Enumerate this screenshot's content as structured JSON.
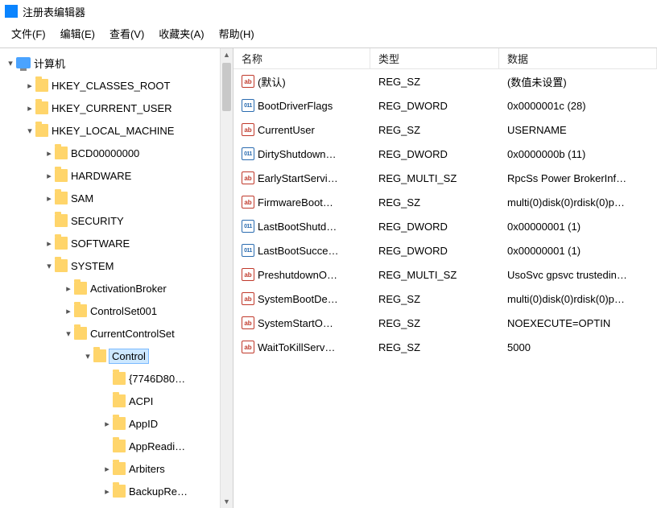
{
  "window": {
    "title": "注册表编辑器"
  },
  "menu": {
    "file": "文件(F)",
    "edit": "编辑(E)",
    "view": "查看(V)",
    "fav": "收藏夹(A)",
    "help": "帮助(H)"
  },
  "tree": {
    "root": "计算机",
    "n0": "HKEY_CLASSES_ROOT",
    "n1": "HKEY_CURRENT_USER",
    "n2": "HKEY_LOCAL_MACHINE",
    "n2_0": "BCD00000000",
    "n2_1": "HARDWARE",
    "n2_2": "SAM",
    "n2_3": "SECURITY",
    "n2_4": "SOFTWARE",
    "n2_5": "SYSTEM",
    "n2_5_0": "ActivationBroker",
    "n2_5_1": "ControlSet001",
    "n2_5_2": "CurrentControlSet",
    "n2_5_2_0": "Control",
    "n2_5_2_0_0": "{7746D80…",
    "n2_5_2_0_1": "ACPI",
    "n2_5_2_0_2": "AppID",
    "n2_5_2_0_3": "AppReadi…",
    "n2_5_2_0_4": "Arbiters",
    "n2_5_2_0_5": "BackupRe…"
  },
  "columns": {
    "name": "名称",
    "type": "类型",
    "data": "数据"
  },
  "values": [
    {
      "icon": "sz",
      "name": "(默认)",
      "type": "REG_SZ",
      "data": "(数值未设置)"
    },
    {
      "icon": "dw",
      "name": "BootDriverFlags",
      "type": "REG_DWORD",
      "data": "0x0000001c (28)"
    },
    {
      "icon": "sz",
      "name": "CurrentUser",
      "type": "REG_SZ",
      "data": "USERNAME"
    },
    {
      "icon": "dw",
      "name": "DirtyShutdown…",
      "type": "REG_DWORD",
      "data": "0x0000000b (11)"
    },
    {
      "icon": "sz",
      "name": "EarlyStartServi…",
      "type": "REG_MULTI_SZ",
      "data": "RpcSs Power BrokerInf…"
    },
    {
      "icon": "sz",
      "name": "FirmwareBoot…",
      "type": "REG_SZ",
      "data": "multi(0)disk(0)rdisk(0)p…"
    },
    {
      "icon": "dw",
      "name": "LastBootShutd…",
      "type": "REG_DWORD",
      "data": "0x00000001 (1)"
    },
    {
      "icon": "dw",
      "name": "LastBootSucce…",
      "type": "REG_DWORD",
      "data": "0x00000001 (1)"
    },
    {
      "icon": "sz",
      "name": "PreshutdownO…",
      "type": "REG_MULTI_SZ",
      "data": "UsoSvc gpsvc trustedin…"
    },
    {
      "icon": "sz",
      "name": "SystemBootDe…",
      "type": "REG_SZ",
      "data": "multi(0)disk(0)rdisk(0)p…"
    },
    {
      "icon": "sz",
      "name": "SystemStartO…",
      "type": "REG_SZ",
      "data": " NOEXECUTE=OPTIN"
    },
    {
      "icon": "sz",
      "name": "WaitToKillServ…",
      "type": "REG_SZ",
      "data": "5000"
    }
  ]
}
